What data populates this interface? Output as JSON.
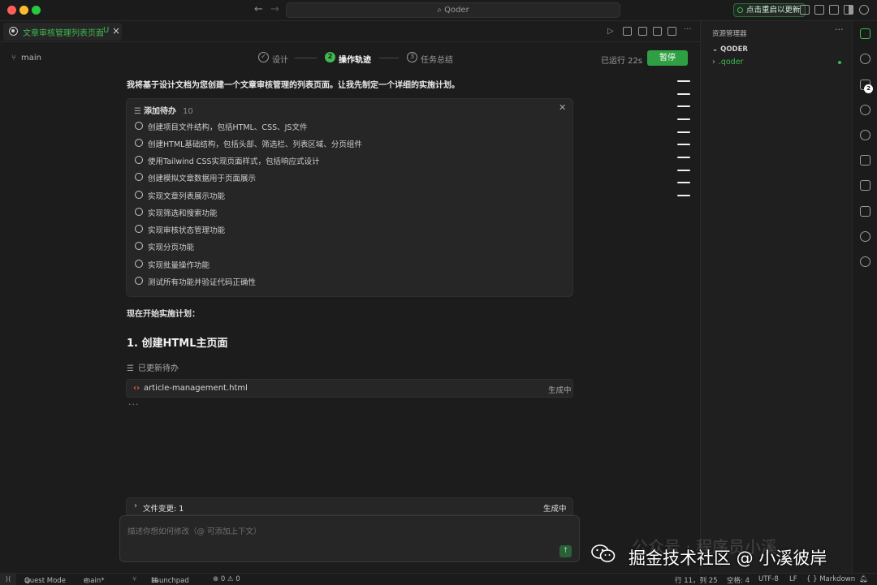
{
  "window": {
    "search_label": "Qoder",
    "update_label": "点击重启以更新"
  },
  "tab": {
    "title": "文章审核管理列表页面",
    "modified": "U",
    "close": "×"
  },
  "header": {
    "branch": "main",
    "steps": [
      {
        "num": "✓",
        "label": "设计"
      },
      {
        "num": "2",
        "label": "操作轨迹"
      },
      {
        "num": "3",
        "label": "任务总结"
      }
    ],
    "runtime": "已运行 22s",
    "pause_label": "暂停"
  },
  "conversation": {
    "intro": "我将基于设计文档为您创建一个文章审核管理的列表页面。让我先制定一个详细的实施计划。",
    "todo": {
      "title": "添加待办",
      "count": "10",
      "items": [
        "创建项目文件结构，包括HTML、CSS、JS文件",
        "创建HTML基础结构，包括头部、筛选栏、列表区域、分页组件",
        "使用Tailwind CSS实现页面样式，包括响应式设计",
        "创建模拟文章数据用于页面展示",
        "实现文章列表展示功能",
        "实现筛选和搜索功能",
        "实现审核状态管理功能",
        "实现分页功能",
        "实现批量操作功能",
        "测试所有功能并验证代码正确性"
      ]
    },
    "start_text": "现在开始实施计划：",
    "section_title": "1. 创建HTML主页面",
    "updated_todo": "已更新待办",
    "file": {
      "name": "article-management.html",
      "status": "生成中"
    },
    "dots": "···"
  },
  "changes": {
    "label": "文件变更: 1",
    "status": "生成中"
  },
  "chat_input": {
    "placeholder": "描述你想如何修改（@ 可添加上下文）"
  },
  "explorer": {
    "title": "资源管理器",
    "section": "QODER",
    "folder": ".qoder"
  },
  "activity": {
    "badge": "2"
  },
  "statusbar": {
    "quest_mode": "Quest Mode",
    "branch": "main*",
    "launchpad": "Launchpad",
    "problems": "⊗ 0 ⚠ 0",
    "position": "行 11，列 25",
    "spaces": "空格: 4",
    "encoding": "UTF-8",
    "eol": "LF",
    "language": "{ } Markdown"
  },
  "watermark": {
    "text": "掘金技术社区 @ 小溪彼岸",
    "ghost": "公众号 · 程序员小溪"
  },
  "colors": {
    "accent": "#3fb950",
    "background": "#1c1c1c",
    "panel": "#262626"
  }
}
